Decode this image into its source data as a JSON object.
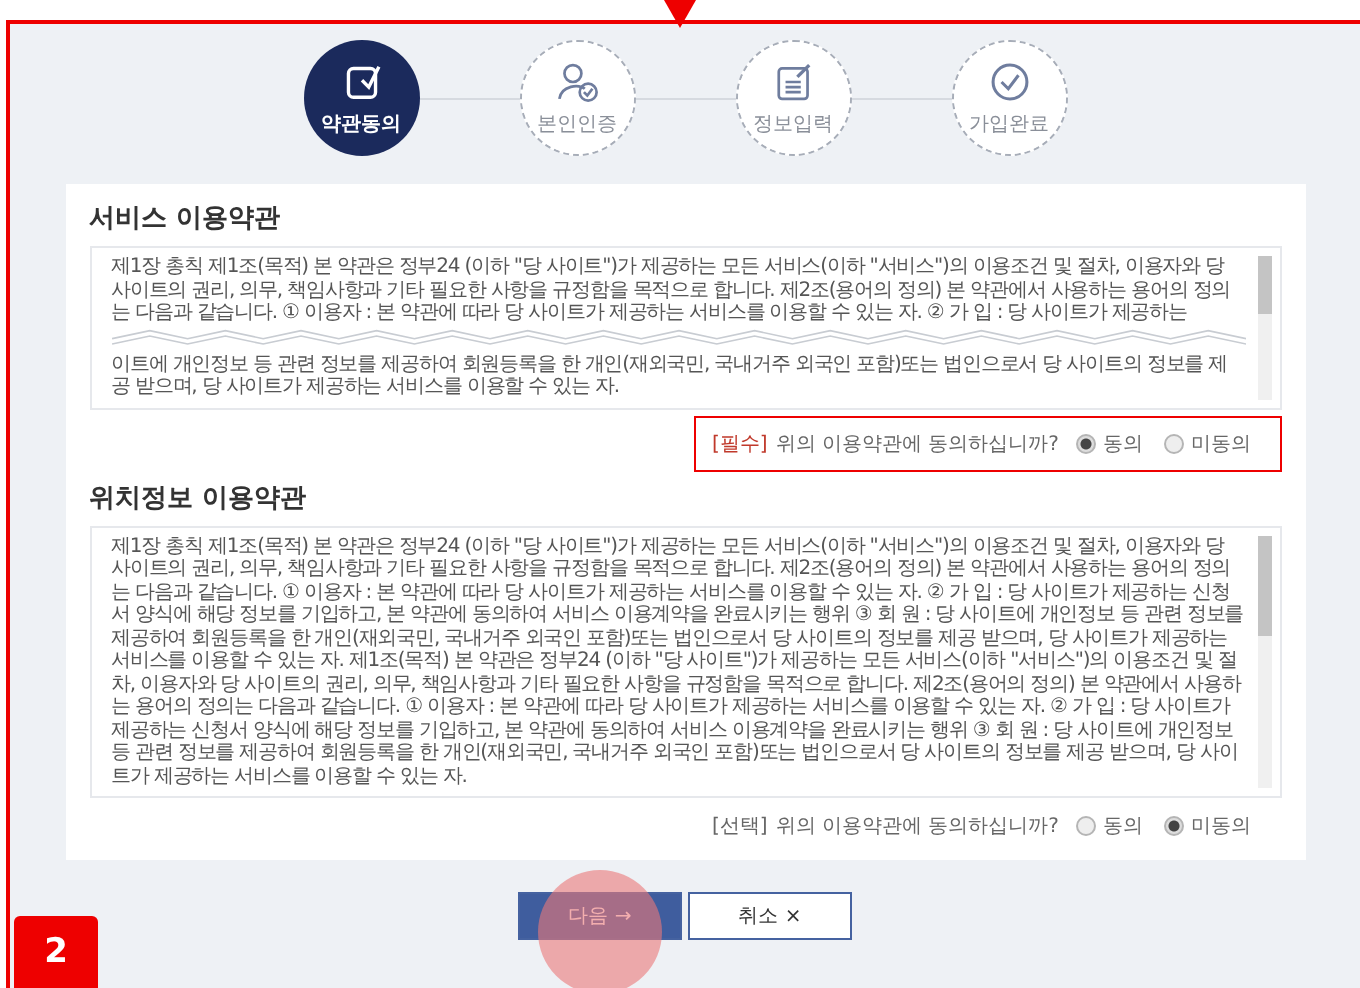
{
  "annotation": {
    "step_number": "2"
  },
  "steps": [
    {
      "label": "약관동의",
      "kind": "agreement",
      "selected": true
    },
    {
      "label": "본인인증",
      "kind": "identity",
      "selected": false
    },
    {
      "label": "정보입력",
      "kind": "form",
      "selected": false
    },
    {
      "label": "가입완료",
      "kind": "complete",
      "selected": false
    }
  ],
  "sections": [
    {
      "title": "서비스 이용약관",
      "highlighted": true,
      "text_parts": [
        "제1장 총칙 제1조(목적) 본 약관은 정부24 (이하 \"당 사이트\")가 제공하는 모든 서비스(이하 \"서비스\")의 이용조건 및 절차, 이용자와 당 사이트의 권리, 의무, 책임사항과 기타 필요한 사항을 규정함을 목적으로 합니다. 제2조(용어의 정의) 본 약관에서 사용하는 용어의 정의는 다음과 같습니다. ① 이용자 : 본 약관에 따라 당 사이트가 제공하는 서비스를 이용할 수 있는 자. ② 가 입 : 당 사이트가 제공하는",
        "이트에 개인정보 등 관련 정보를 제공하여 회원등록을 한 개인(재외국민, 국내거주 외국인 포함)또는 법인으로서 당 사이트의 정보를 제공 받으며, 당 사이트가 제공하는 서비스를 이용할 수 있는 자."
      ],
      "consent": {
        "tag": "[필수]",
        "required": true,
        "question": "위의 이용약관에 동의하십니까?",
        "options": [
          {
            "label": "동의",
            "selected": true
          },
          {
            "label": "미동의",
            "selected": false
          }
        ]
      }
    },
    {
      "title": "위치정보 이용약관",
      "highlighted": false,
      "text_parts": [
        "제1장 총칙 제1조(목적) 본 약관은 정부24 (이하 \"당 사이트\")가 제공하는 모든 서비스(이하 \"서비스\")의 이용조건 및 절차, 이용자와 당 사이트의 권리, 의무, 책임사항과 기타 필요한 사항을 규정함을 목적으로 합니다. 제2조(용어의 정의) 본 약관에서 사용하는 용어의 정의는 다음과 같습니다. ① 이용자 : 본 약관에 따라 당 사이트가 제공하는 서비스를 이용할 수 있는 자. ② 가 입 : 당 사이트가 제공하는 신청서 양식에 해당 정보를 기입하고, 본 약관에 동의하여 서비스 이용계약을 완료시키는 행위 ③ 회 원 : 당 사이트에 개인정보 등 관련 정보를 제공하여 회원등록을 한 개인(재외국민, 국내거주 외국인 포함)또는 법인으로서 당 사이트의 정보를 제공 받으며, 당 사이트가 제공하는 서비스를 이용할 수 있는 자. 제1조(목적) 본 약관은 정부24 (이하 \"당 사이트\")가 제공하는 모든 서비스(이하 \"서비스\")의 이용조건 및 절차, 이용자와 당 사이트의 권리, 의무, 책임사항과 기타 필요한 사항을 규정함을 목적으로 합니다. 제2조(용어의 정의) 본 약관에서 사용하는 용어의 정의는 다음과 같습니다. ① 이용자 : 본 약관에 따라 당 사이트가 제공하는 서비스를 이용할 수 있는 자. ② 가 입 : 당 사이트가 제공하는 신청서 양식에 해당 정보를 기입하고, 본 약관에 동의하여 서비스 이용계약을 완료시키는 행위 ③ 회 원 : 당 사이트에 개인정보 등 관련 정보를 제공하여 회원등록을 한 개인(재외국민, 국내거주 외국인 포함)또는 법인으로서 당 사이트의 정보를 제공 받으며, 당 사이트가 제공하는 서비스를 이용할 수 있는 자."
      ],
      "consent": {
        "tag": "[선택]",
        "required": false,
        "question": "위의 이용약관에 동의하십니까?",
        "options": [
          {
            "label": "동의",
            "selected": false
          },
          {
            "label": "미동의",
            "selected": true
          }
        ]
      }
    }
  ],
  "buttons": [
    {
      "label": "다음 →",
      "kind": "primary",
      "clicked": true
    },
    {
      "label": "취소 ×",
      "kind": "secondary",
      "clicked": false
    }
  ]
}
